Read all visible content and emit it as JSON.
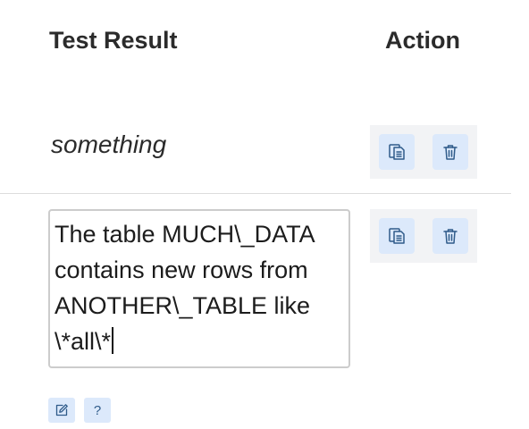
{
  "table": {
    "headers": {
      "test_result": "Test Result",
      "action": "Action"
    },
    "rows": [
      {
        "test_result": "something"
      },
      {
        "test_result": "The table MUCH\\_DATA contains new rows from ANOTHER\\_TABLE like \\*all\\*"
      }
    ]
  },
  "toolbar": {
    "help_label": "?"
  },
  "icons": {
    "copy": "copy-icon",
    "delete": "trash-icon",
    "edit": "edit-icon"
  },
  "colors": {
    "button_bg": "#dce9fb",
    "icon_color": "#2f5b8a",
    "action_cell_bg": "#f2f3f5"
  }
}
